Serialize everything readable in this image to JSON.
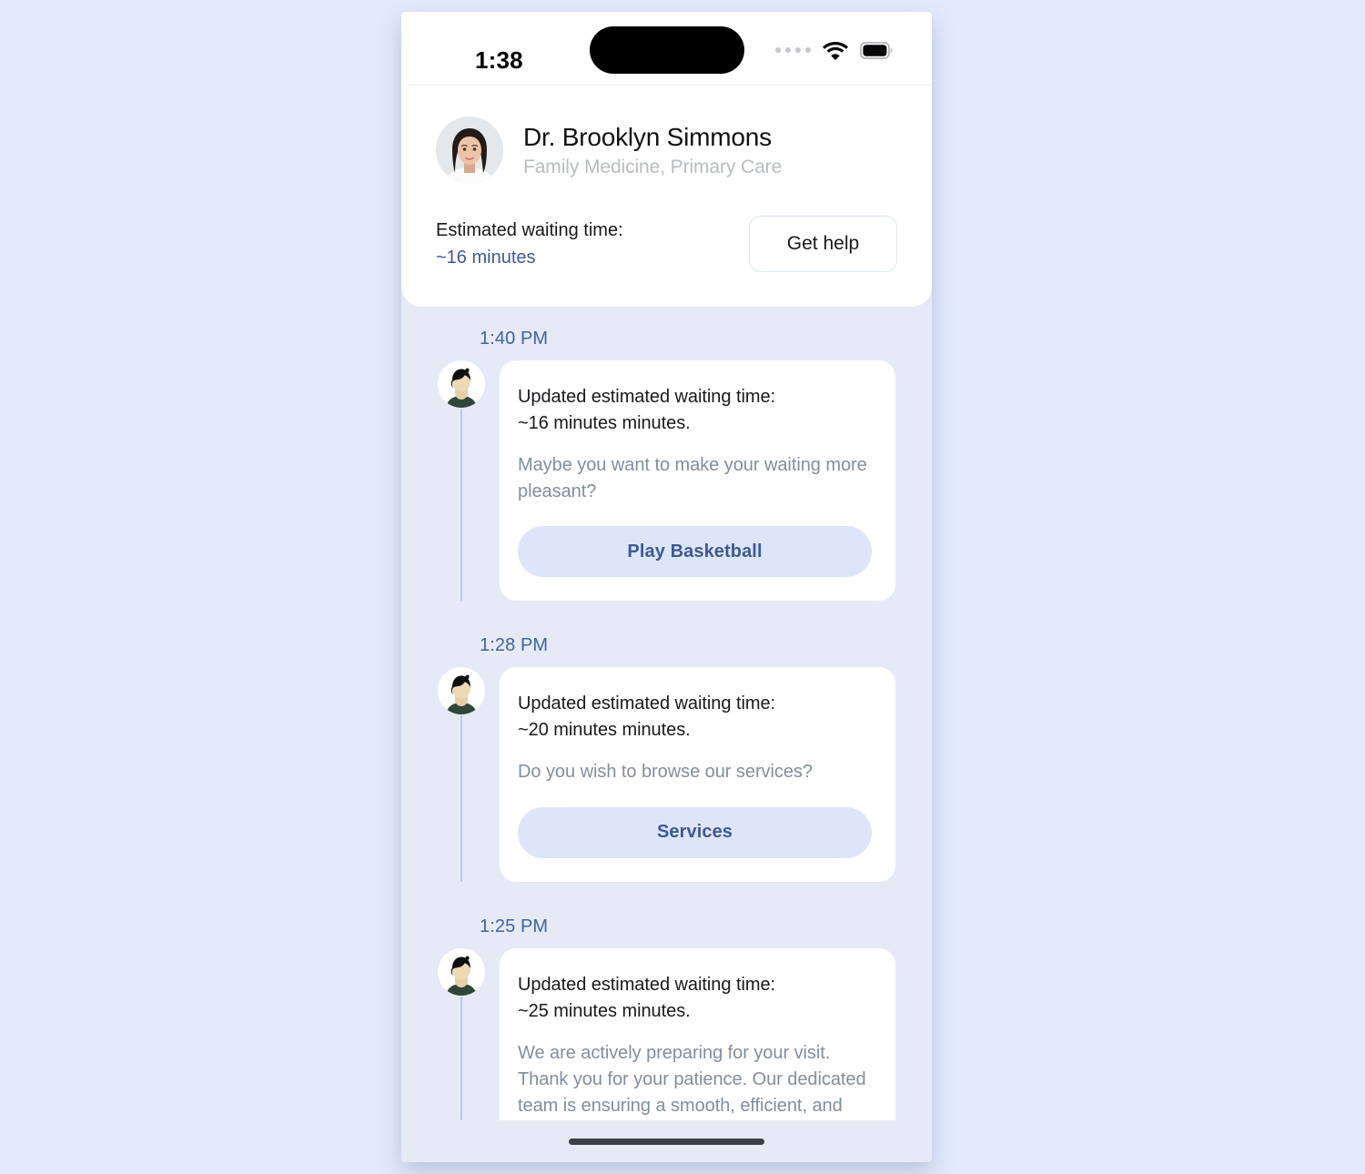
{
  "status_bar": {
    "time": "1:38",
    "cellular_icon": "signal-dots-icon",
    "wifi_icon": "wifi-icon",
    "battery_icon": "battery-full-icon"
  },
  "doctor": {
    "avatar_icon": "doctor-photo",
    "name": "Dr. Brooklyn Simmons",
    "specialty": "Family Medicine, Primary Care",
    "wait_label": "Estimated waiting time:",
    "wait_value": "~16 minutes",
    "get_help_label": "Get help"
  },
  "messages": [
    {
      "time": "1:40 PM",
      "avatar_icon": "bot-avatar-icon",
      "title": "Updated estimated waiting time:\n~16 minutes minutes.",
      "body": "Maybe you want to make your waiting more pleasant?",
      "action_label": "Play Basketball"
    },
    {
      "time": "1:28 PM",
      "avatar_icon": "bot-avatar-icon",
      "title": "Updated estimated waiting time:\n~20 minutes minutes.",
      "body": "Do you wish to browse our services?",
      "action_label": "Services"
    },
    {
      "time": "1:25 PM",
      "avatar_icon": "bot-avatar-icon",
      "title": "Updated estimated waiting time:\n~25 minutes minutes.",
      "body": "We are actively preparing for your visit. Thank you for your patience. Our dedicated team is ensuring a smooth, efficient, and prompt service for you.",
      "action_label": null
    }
  ],
  "home_indicator": "home-indicator",
  "colors": {
    "page_background": "#e3eafc",
    "feed_background": "#e5eaf6",
    "card_background": "#ffffff",
    "accent_blue": "#3d5996",
    "timestamp_blue": "#44639c",
    "action_button_background": "#dde5f8",
    "muted_text": "#848d9b",
    "thread_line": "#b9cbeb"
  }
}
